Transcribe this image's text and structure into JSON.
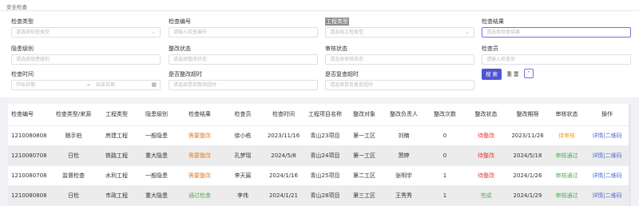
{
  "page": {
    "title": "安全检查"
  },
  "filters": {
    "row1": [
      {
        "label": "检查类型",
        "placeholder": "请选择检查类型",
        "dropdown": true,
        "highlight": false,
        "active": false
      },
      {
        "label": "检查编号",
        "placeholder": "请输入检查编号",
        "dropdown": false,
        "highlight": false,
        "active": false
      },
      {
        "label": "工程类型",
        "placeholder": "请选择工程类型",
        "dropdown": true,
        "highlight": true,
        "active": false
      },
      {
        "label": "检查结果",
        "placeholder": "请选择检查结果",
        "dropdown": false,
        "highlight": false,
        "active": true
      }
    ],
    "row2": [
      {
        "label": "隐患级别",
        "placeholder": "请选择隐患级别"
      },
      {
        "label": "整改状态",
        "placeholder": "请选择整改状态"
      },
      {
        "label": "审核状态",
        "placeholder": "请选择审核状态"
      },
      {
        "label": "检查员",
        "placeholder": "请输入检查员"
      }
    ],
    "row3": {
      "date_label": "检查时间",
      "start_placeholder": "开始日期",
      "end_placeholder": "结束日期",
      "overdue_rect": {
        "label": "是否整改超时",
        "placeholder": "请选择是否整改超时"
      },
      "overdue_review": {
        "label": "是否复查超时",
        "placeholder": "请选择是否复查超时"
      }
    },
    "search_label": "搜 索",
    "reset_label": "重 置",
    "toggle_icon": "chevron-up-icon"
  },
  "table": {
    "columns": [
      "检查编号",
      "检查类型/来源",
      "工程类型",
      "隐患级别",
      "检查结果",
      "检查员",
      "检查时间",
      "工程项目名称",
      "整改对象",
      "整改负责人",
      "整改次数",
      "整改状态",
      "整改期限",
      "审核状态",
      "操作"
    ],
    "rows": [
      {
        "id": "1210080808",
        "type": "随手拍",
        "eng": "房建工程",
        "level": "一般隐患",
        "result": "需要整改",
        "result_color": "warn",
        "inspector": "徐小栋",
        "time": "2023/11/16",
        "project": "青山23项目",
        "target": "第一工区",
        "owner": "刘楠",
        "count": "0",
        "status": "待整改",
        "status_color": "red",
        "deadline": "2023/11/26",
        "audit": "待审核",
        "audit_color": "orange",
        "ops": "详情|二维码"
      },
      {
        "id": "1210080708",
        "type": "日检",
        "eng": "铁路工程",
        "level": "重大隐患",
        "result": "需要整改",
        "result_color": "warn",
        "inspector": "孔梦瑶",
        "time": "2024/5/8",
        "project": "青山24项目",
        "target": "第一工区",
        "owner": "萧婷",
        "count": "0",
        "status": "待整改",
        "status_color": "red",
        "deadline": "2024/5/18",
        "audit": "审核通过",
        "audit_color": "green",
        "ops": "详情|二维码"
      },
      {
        "id": "1210080708",
        "type": "监督检查",
        "eng": "水利工程",
        "level": "一般隐患",
        "result": "需要整改",
        "result_color": "warn",
        "inspector": "李天宸",
        "time": "2024/1/16",
        "project": "青山25项目",
        "target": "第二工区",
        "owner": "张明宇",
        "count": "1",
        "status": "待整改",
        "status_color": "red",
        "deadline": "2024/1/26",
        "audit": "审核通过",
        "audit_color": "green",
        "ops": "详情|二维码"
      },
      {
        "id": "1210080808",
        "type": "日检",
        "eng": "市政工程",
        "level": "重大隐患",
        "result": "通过检查",
        "result_color": "green",
        "inspector": "李伟",
        "time": "2024/1/21",
        "project": "青山28项目",
        "target": "第三工区",
        "owner": "王秀秀",
        "count": "1",
        "status": "完成",
        "status_color": "green",
        "deadline": "2024/1/29",
        "audit": "审核通过",
        "audit_color": "green",
        "ops": "详情|二维码"
      }
    ]
  }
}
